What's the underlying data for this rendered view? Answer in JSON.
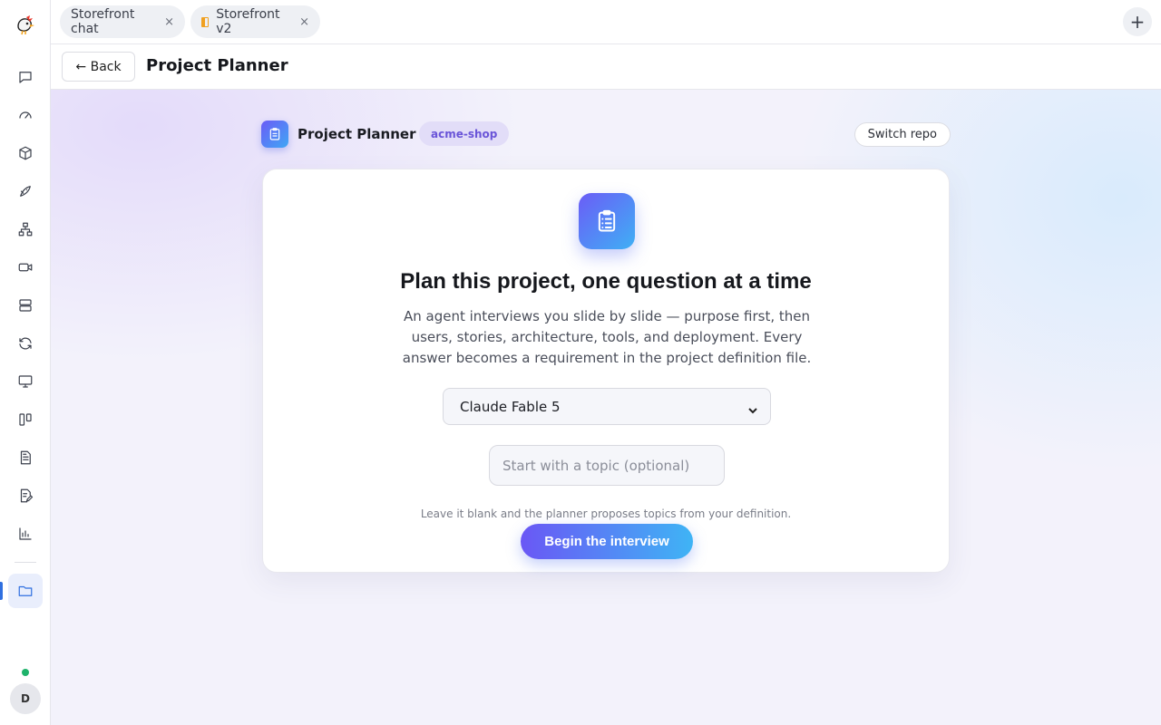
{
  "tabs": [
    {
      "label": "Storefront chat",
      "close": "×"
    },
    {
      "label": "Storefront v2",
      "close": "×",
      "icon": "panel-icon"
    }
  ],
  "add_tab": "+",
  "header": {
    "back_label": "← Back",
    "title": "Project Planner"
  },
  "planner": {
    "title": "Project Planner",
    "repo": "acme-shop",
    "switch_label": "Switch repo"
  },
  "card": {
    "title": "Plan this project, one question at a time",
    "description": "An agent interviews you slide by slide — purpose first, then users, stories, architecture, tools, and deployment. Every answer becomes a requirement in the project definition file.",
    "model_selected": "Claude Fable 5",
    "topic_placeholder": "Start with a topic (optional)",
    "topic_value": "",
    "hint": "Leave it blank and the planner proposes topics from your definition.",
    "begin_label": "Begin the interview"
  },
  "user": {
    "initial": "D",
    "status": "online"
  },
  "colors": {
    "accent": "#2f6fe0",
    "brand_gradient_start": "#6a57f5",
    "brand_gradient_end": "#3fb4f5",
    "status_online": "#1fb36b"
  }
}
